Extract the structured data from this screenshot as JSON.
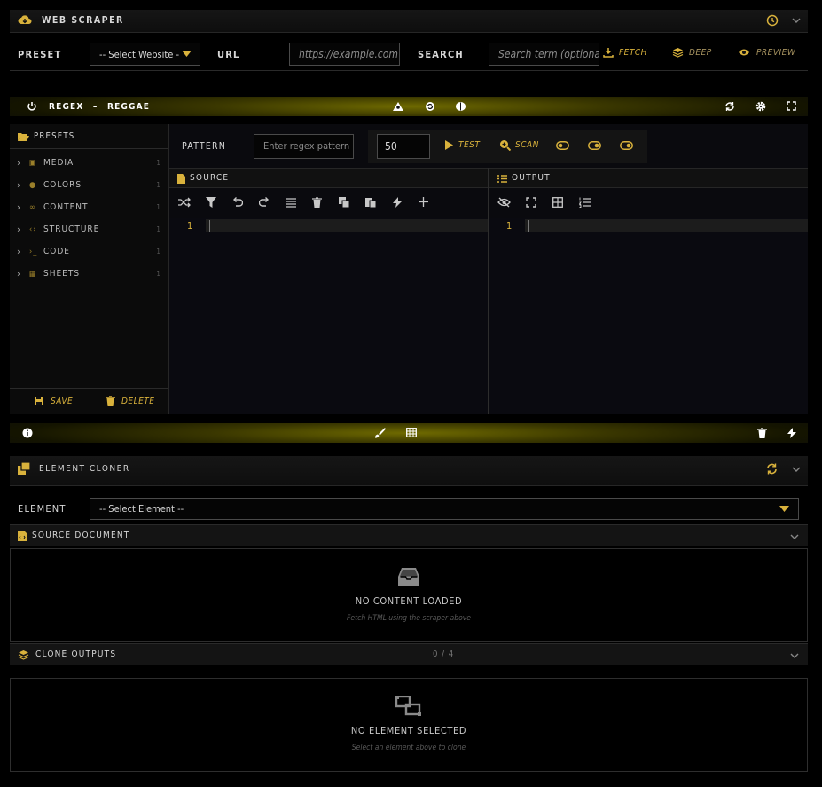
{
  "scraper": {
    "title": "WEB SCRAPER",
    "preset_label": "PRESET",
    "preset_value": "-- Select Website --",
    "url_label": "URL",
    "url_placeholder": "https://example.com",
    "search_label": "SEARCH",
    "search_placeholder": "Search term (optional)",
    "fetch_label": "FETCH",
    "deep_label": "DEEP",
    "preview_label": "PREVIEW"
  },
  "regex": {
    "title": "REGEX",
    "dash": "–",
    "subtitle": "REGGAE",
    "presets_title": "PRESETS",
    "preset_items": [
      {
        "label": "MEDIA",
        "count": "1",
        "icon": "image-icon"
      },
      {
        "label": "COLORS",
        "count": "1",
        "icon": "palette-icon"
      },
      {
        "label": "CONTENT",
        "count": "1",
        "icon": "link-icon"
      },
      {
        "label": "STRUCTURE",
        "count": "1",
        "icon": "code-icon"
      },
      {
        "label": "CODE",
        "count": "1",
        "icon": "terminal-icon"
      },
      {
        "label": "SHEETS",
        "count": "1",
        "icon": "table-icon"
      }
    ],
    "save_label": "SAVE",
    "delete_label": "DELETE",
    "pattern_label": "PATTERN",
    "pattern_placeholder": "Enter regex pattern",
    "limit_value": "50",
    "test_label": "TEST",
    "scan_label": "SCAN",
    "source_title": "SOURCE",
    "output_title": "OUTPUT",
    "source_line": "1",
    "output_line": "1"
  },
  "cloner": {
    "title": "ELEMENT CLONER",
    "element_label": "ELEMENT",
    "element_value": "-- Select Element --",
    "source_doc_title": "SOURCE DOCUMENT",
    "no_content_title": "NO CONTENT LOADED",
    "no_content_sub": "Fetch HTML using the scraper above",
    "clone_outputs_title": "CLONE OUTPUTS",
    "clone_count": "0 / 4",
    "no_element_title": "NO ELEMENT SELECTED",
    "no_element_sub": "Select an element above to clone"
  },
  "colors": {
    "accent": "#d9b23c",
    "glow": "#6f6a00",
    "panel": "#0a0a0f"
  }
}
